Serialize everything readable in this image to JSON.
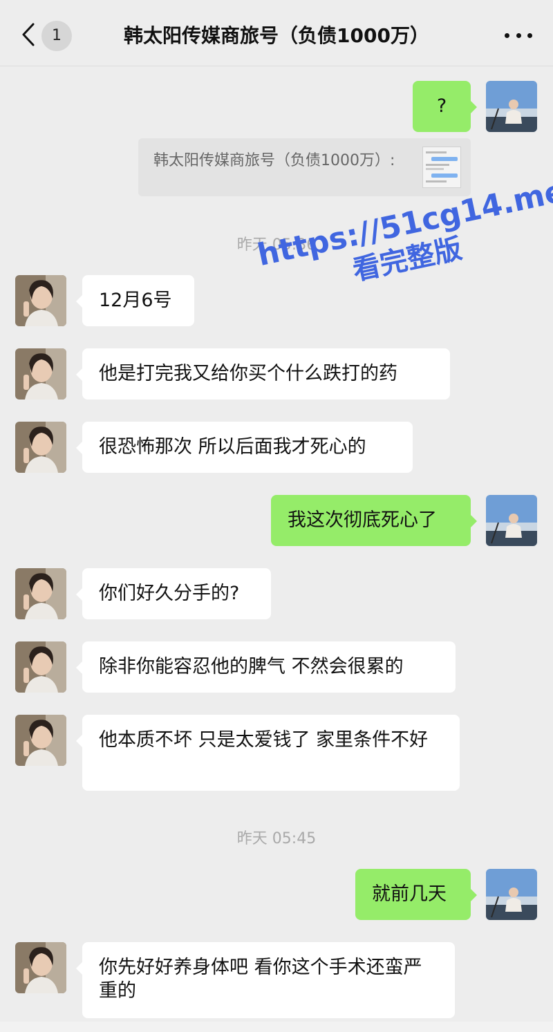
{
  "header": {
    "unread_count": "1",
    "title": "韩太阳传媒商旅号（负债1000万）"
  },
  "quote": {
    "text": "韩太阳传媒商旅号（负债1000万）:"
  },
  "timestamps": [
    "昨天 05:36",
    "昨天 05:45"
  ],
  "messages": [
    {
      "side": "right",
      "text": "?"
    },
    {
      "side": "left",
      "text": "12月6号"
    },
    {
      "side": "left",
      "text": "他是打完我又给你买个什么跌打的药"
    },
    {
      "side": "left",
      "text": "很恐怖那次 所以后面我才死心的"
    },
    {
      "side": "right",
      "text": "我这次彻底死心了"
    },
    {
      "side": "left",
      "text": "你们好久分手的?"
    },
    {
      "side": "left",
      "text": "除非你能容忍他的脾气 不然会很累的"
    },
    {
      "side": "left",
      "text": "他本质不坏 只是太爱钱了 家里条件不好"
    },
    {
      "side": "right",
      "text": "就前几天"
    },
    {
      "side": "left",
      "text": "你先好好养身体吧 看你这个手术还蛮严重的"
    }
  ],
  "watermark": {
    "url": "https://51cg14.me",
    "sub": "看完整版"
  },
  "icons": {
    "back": "chevron-left-icon",
    "more": "more-dots-icon"
  },
  "colors": {
    "background": "#ededed",
    "sent_bubble": "#95ec69",
    "received_bubble": "#ffffff",
    "watermark": "#4066e0"
  }
}
